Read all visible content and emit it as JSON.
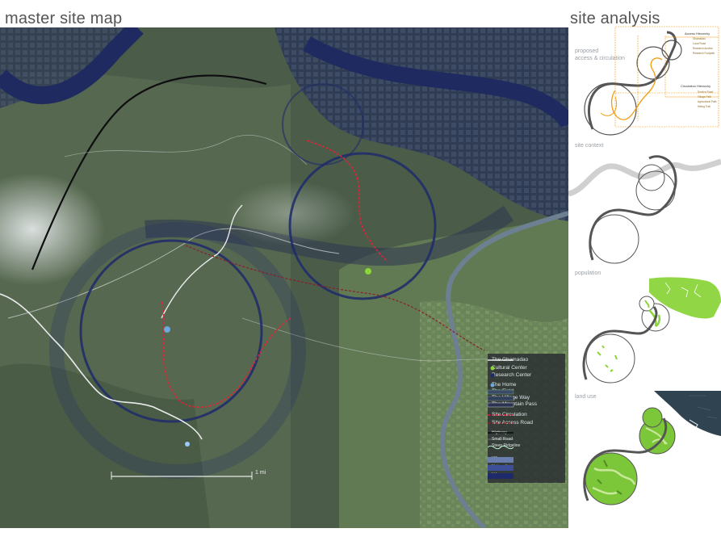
{
  "titles": {
    "map": "master site map",
    "analysis": "site analysis"
  },
  "legend": [
    {
      "label": "The Ghamadao",
      "symbol": "white-line-icon"
    },
    {
      "label": "Cultural Center",
      "symbol": "green-dot-icon"
    },
    {
      "label": "Research Center",
      "symbol": "navy-dot-icon"
    },
    {
      "label": "The Home",
      "symbol": "blue-dot-icon"
    },
    {
      "label": "The Field",
      "symbol": "swatch-icon"
    },
    {
      "label": "The Village Way",
      "symbol": "swatch-icon"
    },
    {
      "label": "The Mountain Pass",
      "symbol": "swatch-icon"
    },
    {
      "label": "Site Circulation",
      "symbol": "red-dashed-icon"
    },
    {
      "label": "Site Access Road",
      "symbol": "darkred-dashed-icon"
    },
    {
      "label": "Highway",
      "symbol": "black-line-icon"
    },
    {
      "label": "Small Road",
      "symbol": "thin-line-icon"
    },
    {
      "label": "Steep Ridgeline",
      "symbol": "wave-icon"
    },
    {
      "label": "Village",
      "symbol": "village-swatch-icon"
    },
    {
      "label": "University",
      "symbol": "university-swatch-icon"
    },
    {
      "label": "Urban",
      "symbol": "urban-swatch-icon"
    }
  ],
  "scale": {
    "label": "1 mi"
  },
  "analysis": {
    "circulation_label_line1": "proposed",
    "circulation_label_line2": "access & circulation",
    "context_label": "site context",
    "population_label": "population",
    "land_use_label": "land use",
    "access_hierarchy": {
      "title": "Access Hierarchy",
      "items": [
        "Ghamadao",
        "Local Road",
        "Research Access",
        "Research Footpath"
      ]
    },
    "circulation_hierarchy": {
      "title": "Circulation Hierarchy",
      "items": [
        "Service Road",
        "Village Path",
        "Agricultural Path",
        "Hiking Trail"
      ]
    }
  },
  "colors": {
    "site_circle": "#1f2a6b",
    "circulation": "#e0233b",
    "population": "#8bd43a",
    "land_use_green": "#7cc63a",
    "urban": "#2f4450",
    "hierarchy": "#f39c12"
  }
}
